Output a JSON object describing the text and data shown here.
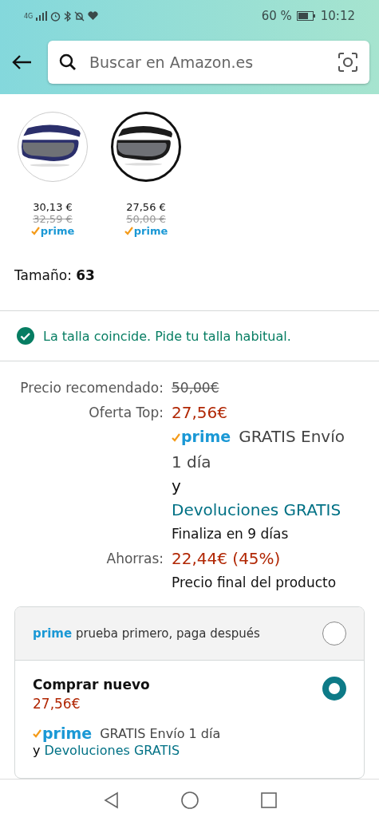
{
  "status_bar": {
    "battery": "60 %",
    "time": "10:12",
    "network": "4G"
  },
  "search": {
    "placeholder": "Buscar en Amazon.es"
  },
  "swatches": [
    {
      "price": "30,13 €",
      "list_price": "32,59 €",
      "prime": "prime",
      "selected": false
    },
    {
      "price": "27,56 €",
      "list_price": "50,00 €",
      "prime": "prime",
      "selected": true
    }
  ],
  "size": {
    "label": "Tamaño:",
    "value": "63"
  },
  "fit_message": "La talla coincide. Pide tu talla habitual.",
  "price_rows": [
    {
      "label": "Precio recomendado:",
      "lines": [
        {
          "kind": "strike",
          "text": "50,00€"
        }
      ]
    },
    {
      "label": "Oferta Top:",
      "lines": [
        {
          "kind": "price",
          "text": "27,56€"
        },
        {
          "kind": "prime",
          "prime": "prime",
          "text": "GRATIS Envío"
        },
        {
          "kind": "cont",
          "text": "1 día"
        },
        {
          "kind": "plain",
          "text": "y"
        },
        {
          "kind": "link",
          "text": "Devoluciones GRATIS"
        },
        {
          "kind": "small",
          "text": "Finaliza en 9 días"
        }
      ]
    },
    {
      "label": "Ahorras:",
      "lines": [
        {
          "kind": "price",
          "text": "22,44€ (45%)"
        },
        {
          "kind": "small",
          "text": "Precio final del producto"
        }
      ]
    }
  ],
  "buy_options": [
    {
      "kind": "prime_trial",
      "prime": "prime",
      "text": "prueba primero, paga después",
      "selected": false
    },
    {
      "kind": "new",
      "title": "Comprar nuevo",
      "price": "27,56€",
      "prime": "prime",
      "shipping": "GRATIS Envío 1 día",
      "and": "y",
      "returns": "Devoluciones GRATIS",
      "selected": true
    }
  ]
}
